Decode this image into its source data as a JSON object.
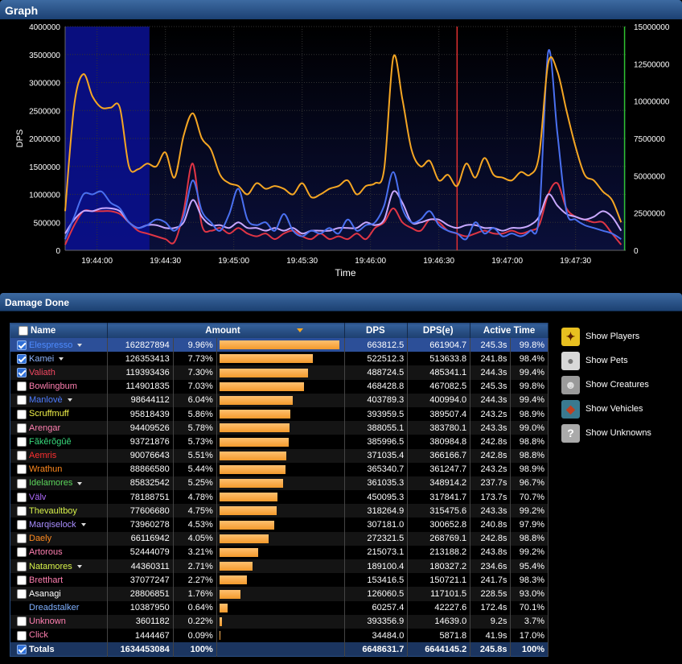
{
  "graph": {
    "title": "Graph",
    "ylabel": "DPS",
    "xlabel": "Time",
    "left_ticks": [
      "4000000",
      "3500000",
      "3000000",
      "2500000",
      "2000000",
      "1500000",
      "1000000",
      "500000",
      "0"
    ],
    "right_ticks": [
      "15000000",
      "12500000",
      "10000000",
      "7500000",
      "5000000",
      "2500000",
      "0"
    ],
    "x_ticks": [
      "19:44:00",
      "19:44:30",
      "19:45:00",
      "19:45:30",
      "19:46:00",
      "19:46:30",
      "19:47:00",
      "19:47:30"
    ]
  },
  "chart_data": {
    "type": "line",
    "x_unit": "seconds from start",
    "ylim": [
      0,
      4000000
    ],
    "y2lim": [
      0,
      15000000
    ],
    "highlight_region_x": [
      0,
      37
    ],
    "markers": [
      {
        "x": 172,
        "color": "#e03030"
      },
      {
        "x": 245.5,
        "color": "#2fc22f"
      }
    ],
    "x": [
      0,
      4,
      8,
      12,
      16,
      20,
      24,
      28,
      32,
      36,
      40,
      44,
      48,
      52,
      56,
      60,
      64,
      68,
      72,
      76,
      80,
      84,
      88,
      92,
      96,
      100,
      104,
      108,
      112,
      116,
      120,
      124,
      128,
      132,
      136,
      140,
      144,
      148,
      152,
      156,
      160,
      164,
      168,
      172,
      176,
      180,
      184,
      188,
      192,
      196,
      200,
      204,
      208,
      212,
      216,
      220,
      224,
      228,
      232,
      236,
      240,
      244
    ],
    "series": [
      {
        "color": "#f5a623",
        "values": [
          700000,
          2600000,
          3150000,
          2750000,
          2550000,
          2550000,
          2550000,
          1500000,
          1450000,
          1550000,
          1500000,
          1750000,
          1300000,
          2050000,
          2450000,
          2000000,
          1800000,
          1350000,
          1200000,
          1150000,
          1000000,
          1200000,
          1100000,
          1150000,
          1100000,
          1000000,
          1200000,
          950000,
          1000000,
          1100000,
          1150000,
          1250000,
          1000000,
          1150000,
          1200000,
          1450000,
          3450000,
          2700000,
          1800000,
          1500000,
          1600000,
          1250000,
          1350000,
          1150000,
          1550000,
          1300000,
          1650000,
          1350000,
          1300000,
          1250000,
          1400000,
          1350000,
          1700000,
          3350000,
          3200000,
          2500000,
          1850000,
          1350000,
          1250000,
          1050000,
          900000,
          500000
        ]
      },
      {
        "color": "#4a70f0",
        "values": [
          200000,
          600000,
          1000000,
          1000000,
          1050000,
          850000,
          750000,
          500000,
          400000,
          450000,
          550000,
          500000,
          350000,
          600000,
          1250000,
          700000,
          500000,
          350000,
          650000,
          1100000,
          550000,
          450000,
          500000,
          350000,
          650000,
          350000,
          250000,
          350000,
          300000,
          400000,
          300000,
          550000,
          350000,
          450000,
          500000,
          800000,
          1400000,
          750000,
          500000,
          550000,
          700000,
          450000,
          350000,
          300000,
          200000,
          500000,
          300000,
          400000,
          250000,
          300000,
          250000,
          350000,
          600000,
          3550000,
          2100000,
          700000,
          550000,
          450000,
          400000,
          350000,
          300000,
          200000
        ]
      },
      {
        "color": "#c8a8ff",
        "values": [
          300000,
          550000,
          700000,
          700000,
          750000,
          750000,
          700000,
          500000,
          400000,
          450000,
          450000,
          400000,
          400000,
          500000,
          900000,
          600000,
          450000,
          450000,
          400000,
          500000,
          400000,
          400000,
          350000,
          400000,
          350000,
          400000,
          300000,
          350000,
          350000,
          350000,
          400000,
          400000,
          400000,
          500000,
          450000,
          550000,
          1050000,
          850000,
          500000,
          500000,
          550000,
          550000,
          450000,
          400000,
          450000,
          450000,
          400000,
          400000,
          350000,
          400000,
          400000,
          450000,
          600000,
          1000000,
          800000,
          650000,
          600000,
          550000,
          600000,
          700000,
          600000,
          350000
        ]
      },
      {
        "color": "#e03545",
        "values": [
          100000,
          450000,
          700000,
          700000,
          700000,
          700000,
          650000,
          500000,
          350000,
          300000,
          250000,
          200000,
          150000,
          700000,
          1550000,
          450000,
          350000,
          400000,
          300000,
          400000,
          300000,
          250000,
          300000,
          200000,
          300000,
          350000,
          250000,
          200000,
          300000,
          200000,
          250000,
          200000,
          300000,
          200000,
          400000,
          500000,
          750000,
          500000,
          400000,
          350000,
          550000,
          500000,
          350000,
          300000,
          250000,
          300000,
          350000,
          300000,
          300000,
          350000,
          300000,
          350000,
          450000,
          1000000,
          1200000,
          750000,
          600000,
          550000,
          500000,
          500000,
          300000,
          100000
        ]
      }
    ]
  },
  "damage": {
    "title": "Damage Done",
    "columns": {
      "name": "Name",
      "amount": "Amount",
      "dps": "DPS",
      "dpse": "DPS(e)",
      "active_time": "Active Time"
    },
    "rows": [
      {
        "name": "Elespresso",
        "checked": true,
        "chev": true,
        "color": "#4d8bff",
        "amount": "162827894",
        "pct": "9.96%",
        "frac": 0.996,
        "dps": "663812.5",
        "dpse": "661904.7",
        "at": "245.3s",
        "ap": "99.8%",
        "selected": true
      },
      {
        "name": "Kamei",
        "checked": true,
        "chev": true,
        "color": "#8eb6ff",
        "amount": "126353413",
        "pct": "7.73%",
        "frac": 0.773,
        "dps": "522512.3",
        "dpse": "513633.8",
        "at": "241.8s",
        "ap": "98.4%"
      },
      {
        "name": "Valiath",
        "checked": true,
        "chev": false,
        "color": "#f44862",
        "amount": "119393436",
        "pct": "7.30%",
        "frac": 0.73,
        "dps": "488724.5",
        "dpse": "485341.1",
        "at": "244.3s",
        "ap": "99.4%"
      },
      {
        "name": "Bowlingbum",
        "checked": false,
        "chev": false,
        "color": "#ff7fb0",
        "amount": "114901835",
        "pct": "7.03%",
        "frac": 0.703,
        "dps": "468428.8",
        "dpse": "467082.5",
        "at": "245.3s",
        "ap": "99.8%"
      },
      {
        "name": "Manlovè",
        "checked": false,
        "chev": true,
        "color": "#4d7bff",
        "amount": "98644112",
        "pct": "6.04%",
        "frac": 0.604,
        "dps": "403789.3",
        "dpse": "400994.0",
        "at": "244.3s",
        "ap": "99.4%"
      },
      {
        "name": "Scruffmuff",
        "checked": false,
        "chev": false,
        "color": "#f2f24a",
        "amount": "95818439",
        "pct": "5.86%",
        "frac": 0.586,
        "dps": "393959.5",
        "dpse": "389507.4",
        "at": "243.2s",
        "ap": "98.9%"
      },
      {
        "name": "Arengar",
        "checked": false,
        "chev": false,
        "color": "#ff7fb0",
        "amount": "94409526",
        "pct": "5.78%",
        "frac": 0.578,
        "dps": "388055.1",
        "dpse": "383780.1",
        "at": "243.3s",
        "ap": "99.0%"
      },
      {
        "name": "Fãkêrõgûê",
        "checked": false,
        "chev": false,
        "color": "#37d87b",
        "amount": "93721876",
        "pct": "5.73%",
        "frac": 0.573,
        "dps": "385996.5",
        "dpse": "380984.8",
        "at": "242.8s",
        "ap": "98.8%"
      },
      {
        "name": "Aemris",
        "checked": false,
        "chev": false,
        "color": "#ff3030",
        "amount": "90076643",
        "pct": "5.51%",
        "frac": 0.551,
        "dps": "371035.4",
        "dpse": "366166.7",
        "at": "242.8s",
        "ap": "98.8%"
      },
      {
        "name": "Wrathun",
        "checked": false,
        "chev": false,
        "color": "#ff8a1f",
        "amount": "88866580",
        "pct": "5.44%",
        "frac": 0.544,
        "dps": "365340.7",
        "dpse": "361247.7",
        "at": "243.2s",
        "ap": "98.9%"
      },
      {
        "name": "Idelamores",
        "checked": false,
        "chev": true,
        "color": "#5cd65c",
        "amount": "85832542",
        "pct": "5.25%",
        "frac": 0.525,
        "dps": "361035.3",
        "dpse": "348914.2",
        "at": "237.7s",
        "ap": "96.7%"
      },
      {
        "name": "Välv",
        "checked": false,
        "chev": false,
        "color": "#b06bff",
        "amount": "78188751",
        "pct": "4.78%",
        "frac": 0.478,
        "dps": "450095.3",
        "dpse": "317841.7",
        "at": "173.7s",
        "ap": "70.7%"
      },
      {
        "name": "Thevaultboy",
        "checked": false,
        "chev": false,
        "color": "#d8f24a",
        "amount": "77606680",
        "pct": "4.75%",
        "frac": 0.475,
        "dps": "318264.9",
        "dpse": "315475.6",
        "at": "243.3s",
        "ap": "99.2%"
      },
      {
        "name": "Marqiselock",
        "checked": false,
        "chev": true,
        "color": "#a98eff",
        "amount": "73960278",
        "pct": "4.53%",
        "frac": 0.453,
        "dps": "307181.0",
        "dpse": "300652.8",
        "at": "240.8s",
        "ap": "97.9%"
      },
      {
        "name": "Daely",
        "checked": false,
        "chev": false,
        "color": "#ff8a1f",
        "amount": "66116942",
        "pct": "4.05%",
        "frac": 0.405,
        "dps": "272321.5",
        "dpse": "268769.1",
        "at": "242.8s",
        "ap": "98.8%"
      },
      {
        "name": "Artorous",
        "checked": false,
        "chev": false,
        "color": "#ff7fb0",
        "amount": "52444079",
        "pct": "3.21%",
        "frac": 0.321,
        "dps": "215073.1",
        "dpse": "213188.2",
        "at": "243.8s",
        "ap": "99.2%"
      },
      {
        "name": "Natamores",
        "checked": false,
        "chev": true,
        "color": "#d8f24a",
        "amount": "44360311",
        "pct": "2.71%",
        "frac": 0.271,
        "dps": "189100.4",
        "dpse": "180327.2",
        "at": "234.6s",
        "ap": "95.4%"
      },
      {
        "name": "Bretthart",
        "checked": false,
        "chev": false,
        "color": "#ff7fb0",
        "amount": "37077247",
        "pct": "2.27%",
        "frac": 0.227,
        "dps": "153416.5",
        "dpse": "150721.1",
        "at": "241.7s",
        "ap": "98.3%"
      },
      {
        "name": "Asanagi",
        "checked": false,
        "chev": false,
        "color": "#ffffff",
        "amount": "28806851",
        "pct": "1.76%",
        "frac": 0.176,
        "dps": "126060.5",
        "dpse": "117101.5",
        "at": "228.5s",
        "ap": "93.0%"
      },
      {
        "name": "Dreadstalker",
        "checked": false,
        "nocheck": true,
        "chev": false,
        "color": "#7fb0ff",
        "amount": "10387950",
        "pct": "0.64%",
        "frac": 0.064,
        "dps": "60257.4",
        "dpse": "42227.6",
        "at": "172.4s",
        "ap": "70.1%"
      },
      {
        "name": "Unknown",
        "checked": false,
        "chev": false,
        "color": "#ff7fb0",
        "amount": "3601182",
        "pct": "0.22%",
        "frac": 0.022,
        "dps": "393356.9",
        "dpse": "14639.0",
        "at": "9.2s",
        "ap": "3.7%"
      },
      {
        "name": "Click",
        "checked": false,
        "chev": false,
        "color": "#ff7fb0",
        "amount": "1444467",
        "pct": "0.09%",
        "frac": 0.009,
        "dps": "34484.0",
        "dpse": "5871.8",
        "at": "41.9s",
        "ap": "17.0%"
      }
    ],
    "totals": {
      "name": "Totals",
      "checked": true,
      "amount": "1634453084",
      "pct": "100%",
      "dps": "6648631.7",
      "dpse": "6644145.2",
      "at": "245.8s",
      "ap": "100%"
    }
  },
  "filters": [
    {
      "label": "Show Players",
      "icon": "players-icon",
      "bg": "#e8c020",
      "fg": "#5a2000"
    },
    {
      "label": "Show Pets",
      "icon": "pets-icon",
      "bg": "#d8d8d8",
      "fg": "#777"
    },
    {
      "label": "Show Creatures",
      "icon": "creatures-icon",
      "bg": "#9a9a9a",
      "fg": "#e0e0e0"
    },
    {
      "label": "Show Vehicles",
      "icon": "vehicles-icon",
      "bg": "#3a7a90",
      "fg": "#c04020"
    },
    {
      "label": "Show Unknowns",
      "icon": "unknowns-icon",
      "bg": "#aaaaaa",
      "fg": "#ffffff"
    }
  ]
}
